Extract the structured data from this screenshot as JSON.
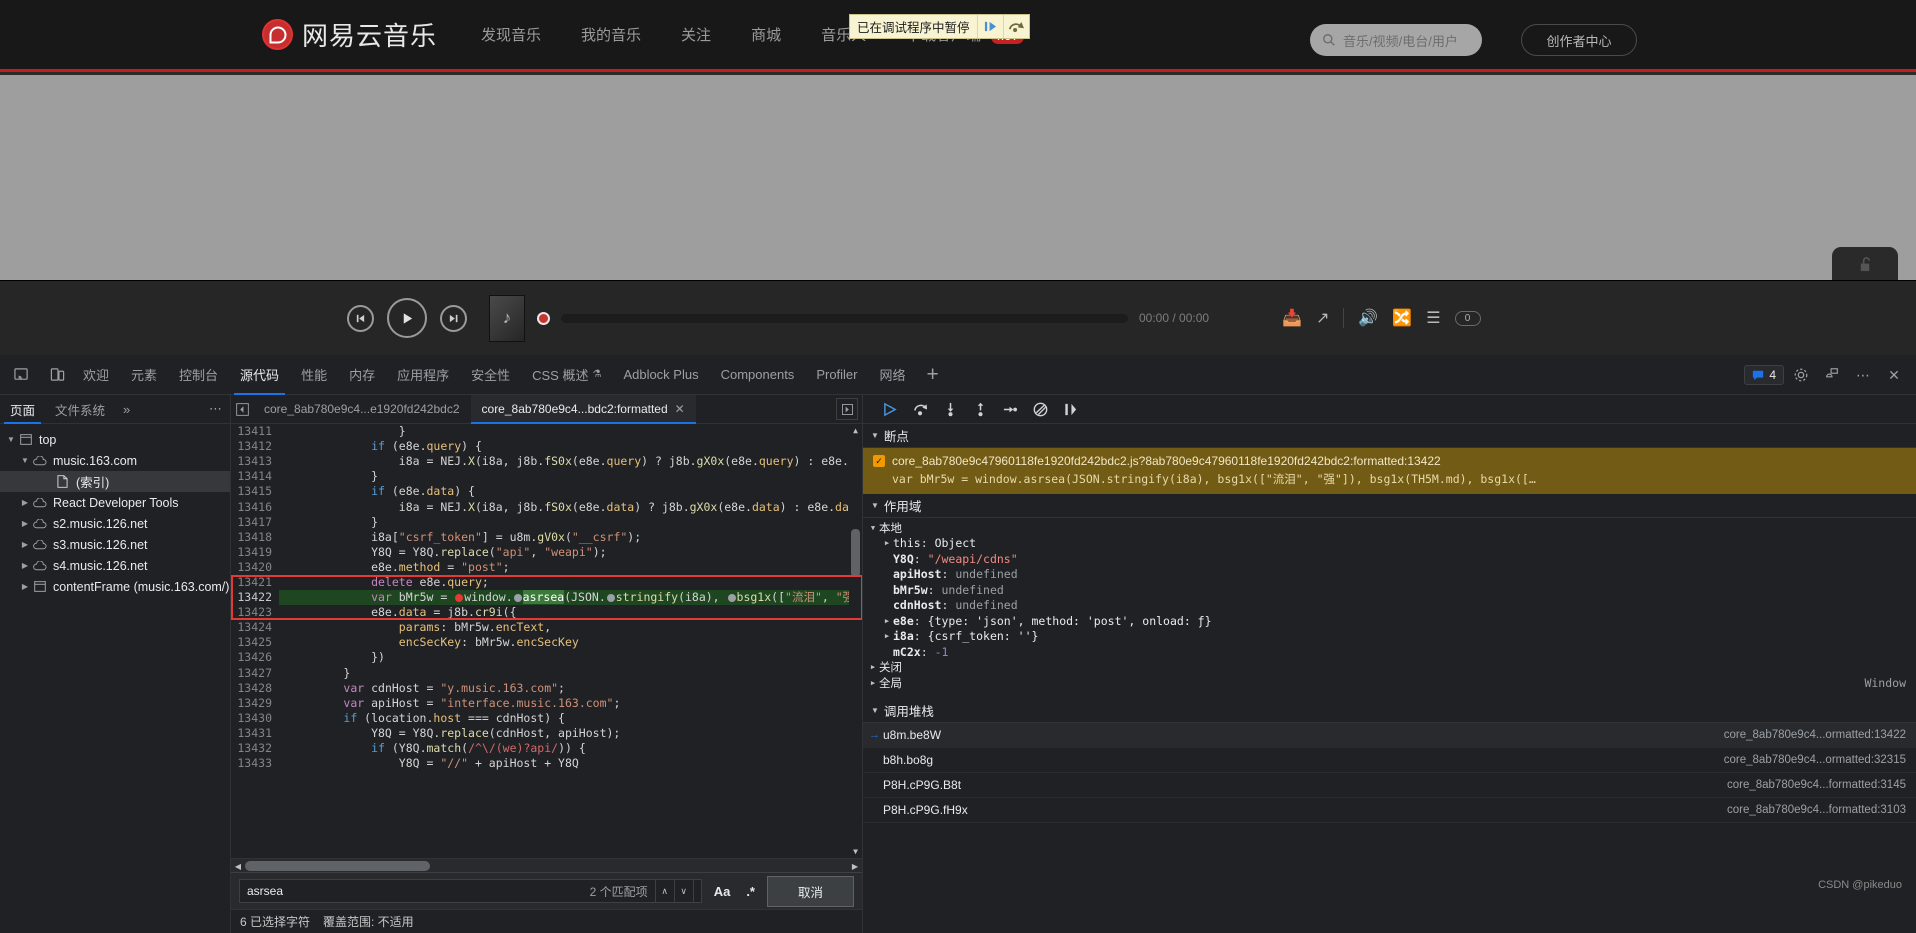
{
  "site": {
    "brand": "网易云音乐",
    "nav": [
      {
        "label": "发现音乐"
      },
      {
        "label": "我的音乐"
      },
      {
        "label": "关注"
      },
      {
        "label": "商城"
      },
      {
        "label": "音乐人"
      },
      {
        "label": "下载客户端",
        "badge": "HOT"
      }
    ],
    "search_placeholder": "音乐/视频/电台/用户",
    "creator_button": "创作者中心",
    "pause_banner": {
      "text": "已在调试程序中暂停",
      "resume_icon": "resume-script-icon",
      "step_icon": "step-over-icon"
    },
    "player": {
      "prev_icon": "previous-track-icon",
      "play_icon": "play-icon",
      "next_icon": "next-track-icon",
      "time": "00:00 / 00:00",
      "add_icon": "add-to-playlist-icon",
      "share_icon": "share-icon",
      "volume_icon": "volume-icon",
      "shuffle_icon": "shuffle-icon",
      "playlist_icon": "playlist-icon",
      "playlist_count": "0"
    },
    "lock_icon": "unlock-icon"
  },
  "devtools": {
    "tabs": [
      {
        "label": "欢迎",
        "active": false
      },
      {
        "label": "元素",
        "active": false
      },
      {
        "label": "控制台",
        "active": false
      },
      {
        "label": "源代码",
        "active": true
      },
      {
        "label": "性能",
        "active": false
      },
      {
        "label": "内存",
        "active": false
      },
      {
        "label": "应用程序",
        "active": false
      },
      {
        "label": "安全性",
        "active": false
      },
      {
        "label": "CSS 概述",
        "active": false,
        "beta": true
      },
      {
        "label": "Adblock Plus",
        "active": false
      },
      {
        "label": "Components",
        "active": false
      },
      {
        "label": "Profiler",
        "active": false
      },
      {
        "label": "网络",
        "active": false
      }
    ],
    "add_tab": "+",
    "message_count": "4",
    "nav_pane": {
      "tabs": [
        {
          "label": "页面",
          "active": true
        },
        {
          "label": "文件系统",
          "active": false
        }
      ],
      "overflow": "»",
      "more": "⋯",
      "tree": [
        {
          "depth": 0,
          "twisty": "▼",
          "icon": "frame-icon",
          "label": "top",
          "selected": false
        },
        {
          "depth": 1,
          "twisty": "▼",
          "icon": "cloud-icon",
          "label": "music.163.com",
          "selected": false
        },
        {
          "depth": 2,
          "twisty": "",
          "icon": "document-icon",
          "label": "(索引)",
          "selected": true
        },
        {
          "depth": 1,
          "twisty": "▶",
          "icon": "cloud-icon",
          "label": "React Developer Tools",
          "selected": false
        },
        {
          "depth": 1,
          "twisty": "▶",
          "icon": "cloud-icon",
          "label": "s2.music.126.net",
          "selected": false
        },
        {
          "depth": 1,
          "twisty": "▶",
          "icon": "cloud-icon",
          "label": "s3.music.126.net",
          "selected": false
        },
        {
          "depth": 1,
          "twisty": "▶",
          "icon": "cloud-icon",
          "label": "s4.music.126.net",
          "selected": false
        },
        {
          "depth": 1,
          "twisty": "▶",
          "icon": "frame-icon",
          "label": "contentFrame (music.163.com/)",
          "selected": false
        }
      ]
    },
    "file_tabs": [
      {
        "label": "core_8ab780e9c4...e1920fd242bdc2",
        "active": false,
        "closable": false
      },
      {
        "label": "core_8ab780e9c4...bdc2:formatted",
        "active": true,
        "closable": true
      }
    ],
    "code": {
      "first_line": 13411,
      "lines": [
        {
          "n": 13411,
          "partial": true
        },
        {
          "n": 13412
        },
        {
          "n": 13413
        },
        {
          "n": 13414
        },
        {
          "n": 13415
        },
        {
          "n": 13416
        },
        {
          "n": 13417
        },
        {
          "n": 13418
        },
        {
          "n": 13419
        },
        {
          "n": 13420
        },
        {
          "n": 13421
        },
        {
          "n": 13422,
          "breakpoint": true,
          "executing": true
        },
        {
          "n": 13423
        },
        {
          "n": 13424
        },
        {
          "n": 13425
        },
        {
          "n": 13426
        },
        {
          "n": 13427
        },
        {
          "n": 13428
        },
        {
          "n": 13429
        },
        {
          "n": 13430
        },
        {
          "n": 13431
        },
        {
          "n": 13432
        },
        {
          "n": 13433
        }
      ]
    },
    "find": {
      "query": "asrsea",
      "matches": "2 个匹配项",
      "match_case_icon": "Aa",
      "regex_icon": ".*",
      "cancel": "取消",
      "prev_icon": "∧",
      "next_icon": "∨"
    },
    "status": {
      "selection": "6 已选择字符",
      "coverage": "覆盖范围: 不适用"
    },
    "debugger": {
      "toolbar": [
        {
          "name": "resume-script-icon"
        },
        {
          "name": "step-over-icon"
        },
        {
          "name": "step-into-icon"
        },
        {
          "name": "step-out-icon"
        },
        {
          "name": "step-icon"
        },
        {
          "name": "deactivate-breakpoints-icon"
        },
        {
          "name": "pause-on-exceptions-icon"
        }
      ],
      "breakpoints": {
        "title": "断点",
        "items": [
          {
            "checked": true,
            "location": "core_8ab780e9c47960118fe1920fd242bdc2.js?8ab780e9c47960118fe1920fd242bdc2:formatted:13422",
            "code": "var bMr5w = window.asrsea(JSON.stringify(i8a), bsg1x([\"流泪\", \"强\"]), bsg1x(TH5M.md), bsg1x([…"
          }
        ]
      },
      "scope": {
        "title": "作用域",
        "groups": [
          {
            "name": "本地",
            "expanded": true,
            "rows": [
              {
                "arrow": "▶",
                "name": "this",
                "value": "Object",
                "vtype": "obj",
                "bold": false
              },
              {
                "arrow": "",
                "name": "Y8Q",
                "value": "\"/weapi/cdns\"",
                "vtype": "str",
                "bold": true
              },
              {
                "arrow": "",
                "name": "apiHost",
                "value": "undefined",
                "vtype": "undef",
                "bold": true
              },
              {
                "arrow": "",
                "name": "bMr5w",
                "value": "undefined",
                "vtype": "undef",
                "bold": true
              },
              {
                "arrow": "",
                "name": "cdnHost",
                "value": "undefined",
                "vtype": "undef",
                "bold": true
              },
              {
                "arrow": "▶",
                "name": "e8e",
                "value": "{type: 'json', method: 'post', onload: ƒ}",
                "vtype": "obj",
                "bold": true
              },
              {
                "arrow": "▶",
                "name": "i8a",
                "value": "{csrf_token: ''}",
                "vtype": "obj",
                "bold": true
              },
              {
                "arrow": "",
                "name": "mC2x",
                "value": "-1",
                "vtype": "num",
                "bold": true
              }
            ]
          },
          {
            "name": "关闭",
            "expanded": false,
            "rows": []
          },
          {
            "name": "全局",
            "expanded": false,
            "rows": [],
            "right_label": "Window"
          }
        ]
      },
      "callstack": {
        "title": "调用堆栈",
        "frames": [
          {
            "fn": "u8m.be8W",
            "loc": "core_8ab780e9c4...ormatted:13422",
            "current": true
          },
          {
            "fn": "b8h.bo8g",
            "loc": "core_8ab780e9c4...ormatted:32315",
            "current": false
          },
          {
            "fn": "P8H.cP9G.B8t",
            "loc": "core_8ab780e9c4...formatted:3145",
            "current": false
          },
          {
            "fn": "P8H.cP9G.fH9x",
            "loc": "core_8ab780e9c4...formatted:3103",
            "current": false
          }
        ]
      }
    },
    "watermark": "CSDN @pikeduo"
  }
}
